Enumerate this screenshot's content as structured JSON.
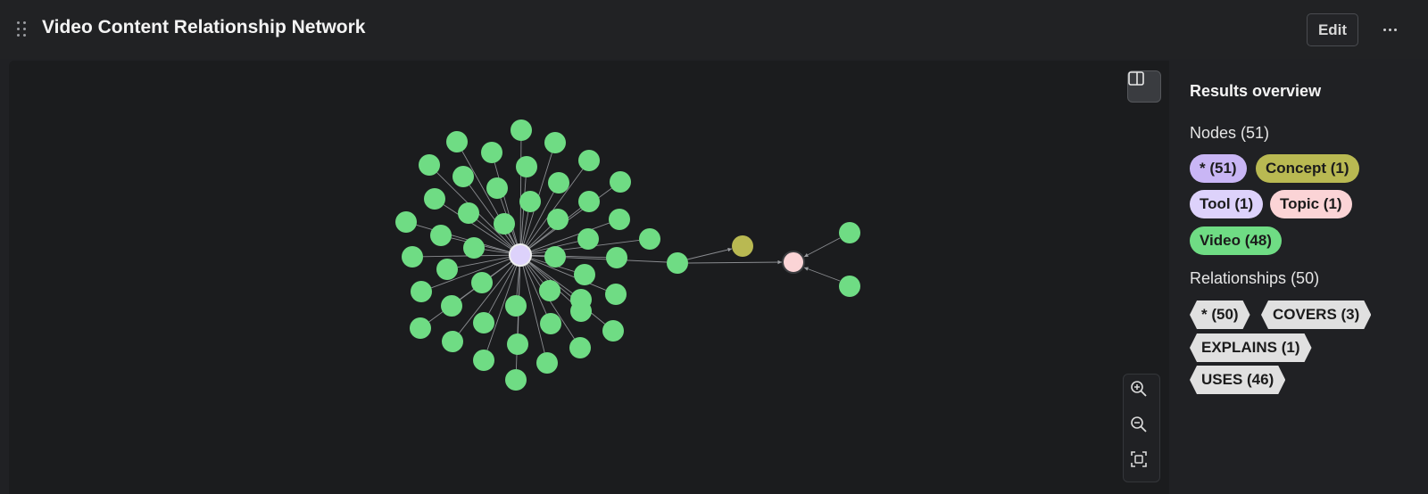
{
  "header": {
    "title": "Video Content Relationship Network",
    "edit_label": "Edit"
  },
  "overview": {
    "title": "Results overview",
    "nodes_label": "Nodes (51)",
    "node_labels": [
      {
        "text": "* (51)",
        "color": "#c9b6f5"
      },
      {
        "text": "Concept (1)",
        "color": "#b9b952"
      },
      {
        "text": "Tool (1)",
        "color": "#ddd2fb"
      },
      {
        "text": "Topic (1)",
        "color": "#fbd4d6"
      },
      {
        "text": "Video (48)",
        "color": "#6fdc84"
      }
    ],
    "relationships_label": "Relationships (50)",
    "rel_types": [
      {
        "text": "* (50)"
      },
      {
        "text": "COVERS (3)"
      },
      {
        "text": "EXPLAINS (1)"
      },
      {
        "text": "USES (46)"
      }
    ]
  },
  "graph": {
    "colors": {
      "video": "#6fdc84",
      "tool": "#ddd2fb",
      "topic": "#fbd4d6",
      "concept": "#b9b952",
      "edge": "#8a8c90"
    },
    "node_counts": {
      "video": 48,
      "tool": 1,
      "topic": 1,
      "concept": 1
    },
    "relationship_counts": {
      "uses": 46,
      "covers": 3,
      "explains": 1
    }
  }
}
